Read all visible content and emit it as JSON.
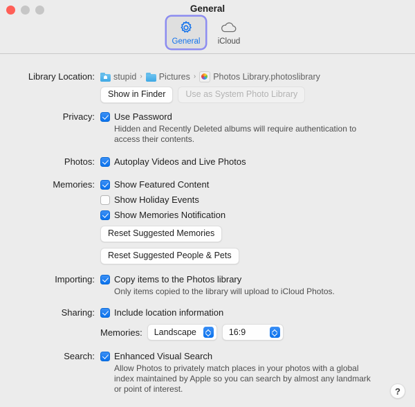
{
  "window": {
    "title": "General",
    "traffic_lights": [
      "close",
      "minimize",
      "maximize"
    ]
  },
  "toolbar": {
    "items": [
      {
        "label": "General",
        "icon": "gear-icon",
        "selected": true
      },
      {
        "label": "iCloud",
        "icon": "cloud-icon",
        "selected": false
      }
    ]
  },
  "sections": {
    "library_location": {
      "label": "Library Location:",
      "breadcrumb": [
        {
          "name": "stupid",
          "icon": "home-folder-icon"
        },
        {
          "name": "Pictures",
          "icon": "folder-icon"
        },
        {
          "name": "Photos Library.photoslibrary",
          "icon": "photos-library-icon"
        }
      ],
      "separator": "›",
      "show_in_finder_label": "Show in Finder",
      "use_as_system_label": "Use as System Photo Library",
      "use_as_system_disabled": true
    },
    "privacy": {
      "label": "Privacy:",
      "use_password_label": "Use Password",
      "use_password_checked": true,
      "hint": "Hidden and Recently Deleted albums will require authentication to access their contents."
    },
    "photos": {
      "label": "Photos:",
      "autoplay_label": "Autoplay Videos and Live Photos",
      "autoplay_checked": true
    },
    "memories": {
      "label": "Memories:",
      "checkboxes": [
        {
          "label": "Show Featured Content",
          "checked": true
        },
        {
          "label": "Show Holiday Events",
          "checked": false
        },
        {
          "label": "Show Memories Notification",
          "checked": true
        }
      ],
      "reset_memories_label": "Reset Suggested Memories",
      "reset_people_label": "Reset Suggested People & Pets"
    },
    "importing": {
      "label": "Importing:",
      "copy_items_label": "Copy items to the Photos library",
      "copy_items_checked": true,
      "hint": "Only items copied to the library will upload to iCloud Photos."
    },
    "sharing": {
      "label": "Sharing:",
      "include_location_label": "Include location information",
      "include_location_checked": true,
      "memories_sub_label": "Memories:",
      "orientation_value": "Landscape",
      "aspect_value": "16:9"
    },
    "search": {
      "label": "Search:",
      "enhanced_label": "Enhanced Visual Search",
      "enhanced_checked": true,
      "hint": "Allow Photos to privately match places in your photos with a global index maintained by Apple so you can search by almost any landmark or point of interest."
    }
  },
  "help_button": {
    "glyph": "?"
  },
  "colors": {
    "accent": "#0a72ed",
    "window_bg": "#ececec",
    "focus_ring": "#8c8cf0",
    "close_red": "#ff5f57"
  }
}
